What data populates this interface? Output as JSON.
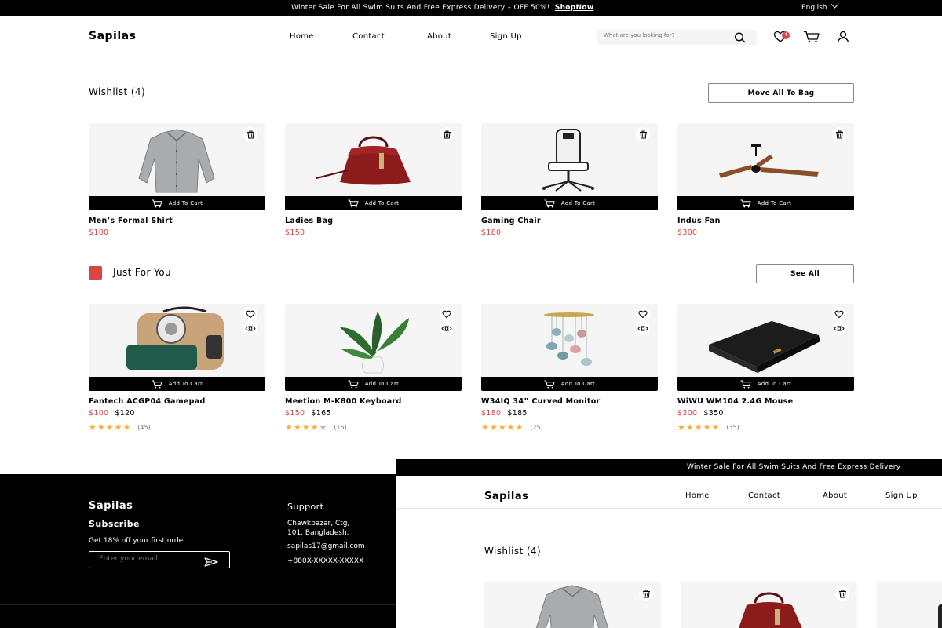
{
  "topbar": {
    "promo": "Winter Sale  For All Swim Suits And Free Express Delivery – OFF 50%!",
    "promo_link": "ShopNow",
    "language": "English"
  },
  "header": {
    "logo": "Sapilas",
    "nav": [
      "Home",
      "Contact",
      "About",
      "Sign Up"
    ],
    "search_placeholder": "What are you looking for?",
    "wishlist_count": "4"
  },
  "wishlist": {
    "title": "Wishlist (4)",
    "move_all": "Move All To Bag",
    "add_to_cart": "Add To Cart",
    "items": [
      {
        "name": "Men’s Formal Shirt",
        "price": "$100"
      },
      {
        "name": "Ladies Bag",
        "price": "$150"
      },
      {
        "name": "Gaming Chair",
        "price": "$180"
      },
      {
        "name": "Indus Fan",
        "price": "$300"
      }
    ]
  },
  "just_for_you": {
    "title": "Just For You",
    "see_all": "See All",
    "items": [
      {
        "name": "Fantech ACGP04 Gamepad",
        "price": "$100",
        "old_price": "$120",
        "rating": 5,
        "reviews": "(45)"
      },
      {
        "name": "Meetion M-K800 Keyboard",
        "price": "$150",
        "old_price": "$165",
        "rating": 4,
        "reviews": "(15)"
      },
      {
        "name": "W34IQ 34”  Curved Monitor",
        "price": "$180",
        "old_price": "$185",
        "rating": 5,
        "reviews": "(25)"
      },
      {
        "name": "WiWU WM104 2.4G Mouse",
        "price": "$300",
        "old_price": "$350",
        "rating": 5,
        "reviews": "(35)"
      }
    ]
  },
  "footer": {
    "logo": "Sapilas",
    "subscribe": "Subscribe",
    "offer": "Get 18% off your first order",
    "email_placeholder": "Enter your email",
    "support_title": "Support",
    "address_1": "Chawkbazar, Ctg,",
    "address_2": " 101, Bangladesh.",
    "email": "sapilas17@gmail.com",
    "phone": "+880X-XXXXX-XXXXX"
  },
  "overlay": {
    "promo": "Winter Sale  For All Swim Suits And Free Express Delivery",
    "logo": "Sapilas",
    "nav": [
      "Home",
      "Contact",
      "About",
      "Sign Up"
    ],
    "wishlist_title": "Wishlist (4)"
  },
  "colors": {
    "accent": "#db4444",
    "star": "#ffad33",
    "card_bg": "#f5f5f5"
  }
}
